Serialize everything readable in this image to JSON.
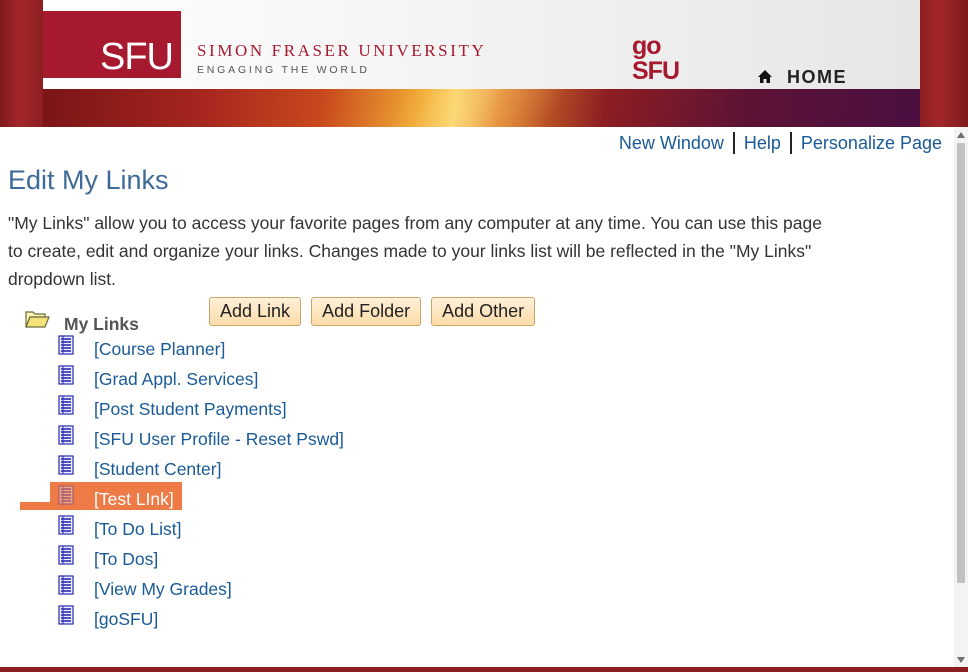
{
  "header": {
    "logo_text": "SFU",
    "university_name": "SIMON FRASER UNIVERSITY",
    "tagline": "ENGAGING THE WORLD",
    "gosfu_line1": "go",
    "gosfu_line2": "SFU",
    "home_label": "HOME",
    "home_icon": "home-icon"
  },
  "toolbar": {
    "new_window": "New Window",
    "help": "Help",
    "personalize": "Personalize Page"
  },
  "page": {
    "title": "Edit My Links",
    "intro": "\"My Links\" allow you to access your favorite pages from any computer at any time. You can use this page to create, edit and organize your links. Changes made to your links list will be reflected in the \"My Links\" dropdown list."
  },
  "tree": {
    "root_label": "My Links",
    "root_icon": "folder-open-icon",
    "buttons": {
      "add_link": "Add Link",
      "add_folder": "Add Folder",
      "add_other": "Add Other"
    },
    "items": [
      {
        "label": "[Course Planner]",
        "highlighted": false
      },
      {
        "label": "[Grad Appl. Services]",
        "highlighted": false
      },
      {
        "label": "[Post Student Payments]",
        "highlighted": false
      },
      {
        "label": "[SFU User Profile - Reset Pswd]",
        "highlighted": false
      },
      {
        "label": "[Student Center]",
        "highlighted": false
      },
      {
        "label": "[Test LInk]",
        "highlighted": true
      },
      {
        "label": "[To Do List]",
        "highlighted": false
      },
      {
        "label": "[To Dos]",
        "highlighted": false
      },
      {
        "label": "[View My Grades]",
        "highlighted": false
      },
      {
        "label": "[goSFU]",
        "highlighted": false
      }
    ]
  },
  "colors": {
    "brand_red": "#a6192e",
    "link_blue": "#1a5a96",
    "title_blue": "#3e6a99",
    "highlight": "#ee7a45"
  }
}
